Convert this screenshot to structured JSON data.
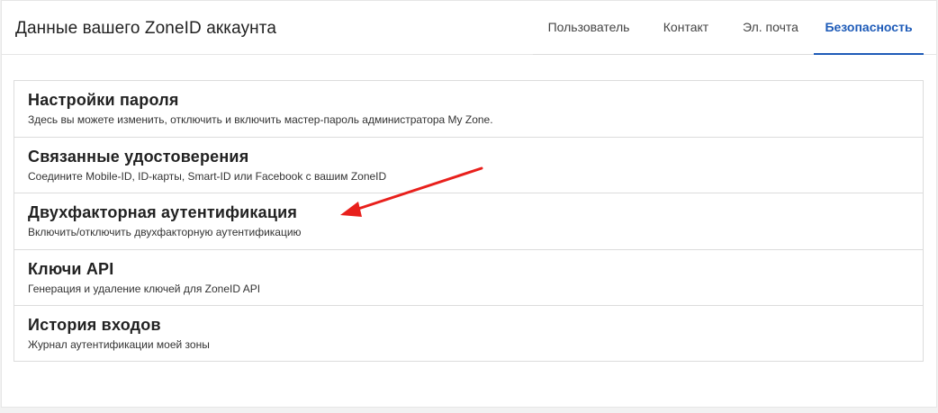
{
  "header": {
    "title": "Данные вашего ZoneID аккаунта",
    "tabs": [
      {
        "label": "Пользователь"
      },
      {
        "label": "Контакт"
      },
      {
        "label": "Эл. почта"
      },
      {
        "label": "Безопасность",
        "active": true
      }
    ]
  },
  "security": {
    "items": [
      {
        "title": "Настройки пароля",
        "description": "Здесь вы можете изменить, отключить и включить мастер-пароль администратора My Zone."
      },
      {
        "title": "Связанные удостоверения",
        "description": "Соедините Mobile-ID, ID-карты, Smart-ID или Facebook с вашим ZoneID"
      },
      {
        "title": "Двухфакторная аутентификация",
        "description": "Включить/отключить двухфакторную аутентификацию"
      },
      {
        "title": "Ключи API",
        "description": "Генерация и удаление ключей для ZoneID API"
      },
      {
        "title": "История входов",
        "description": "Журнал аутентификации моей зоны"
      }
    ]
  },
  "colors": {
    "accent": "#1e5bb8",
    "annotation_arrow": "#e8201c"
  },
  "annotation": {
    "icon": "red-arrow-icon"
  }
}
